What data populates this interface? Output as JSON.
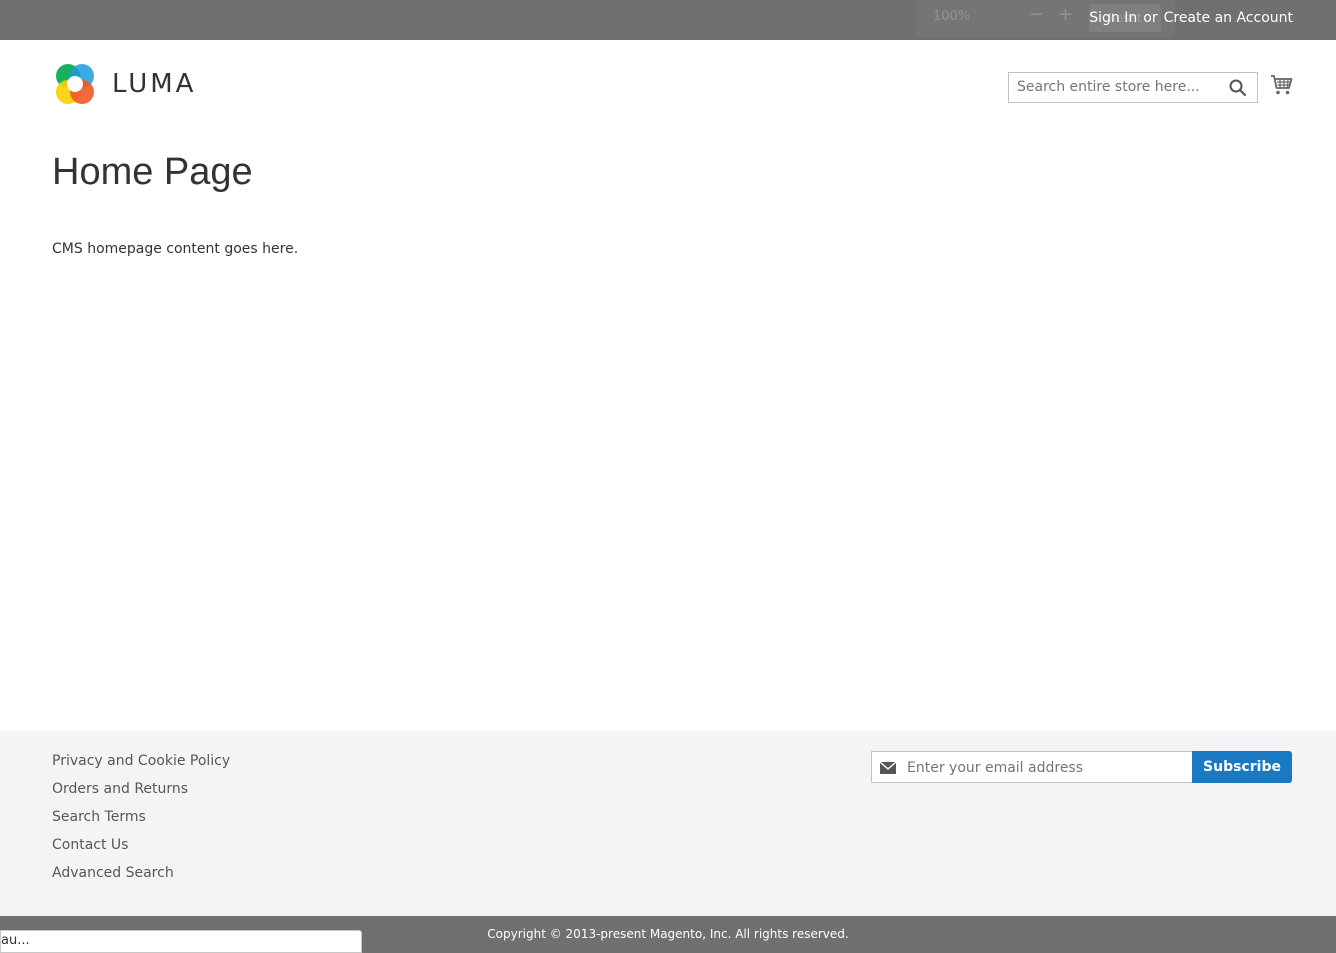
{
  "header": {
    "zoom": {
      "value": "100%",
      "minus": "−",
      "plus": "+",
      "reset": "Reset"
    },
    "sign_in": "Sign In",
    "or": "or",
    "create_account": "Create an Account"
  },
  "brand": {
    "logo_text": "LUMA"
  },
  "search": {
    "placeholder": "Search entire store here..."
  },
  "main": {
    "title": "Home Page",
    "content": "CMS homepage content goes here."
  },
  "footer": {
    "links": [
      "Privacy and Cookie Policy",
      "Orders and Returns",
      "Search Terms",
      "Contact Us",
      "Advanced Search"
    ],
    "newsletter": {
      "placeholder": "Enter your email address",
      "button": "Subscribe"
    },
    "copyright": "Copyright © 2013-present Magento, Inc. All rights reserved."
  },
  "overlay": {
    "partial_text": "au..."
  },
  "colors": {
    "header_bg": "#6e716e",
    "accent": "#1979c3",
    "footer_bg": "#f4f4f4"
  }
}
